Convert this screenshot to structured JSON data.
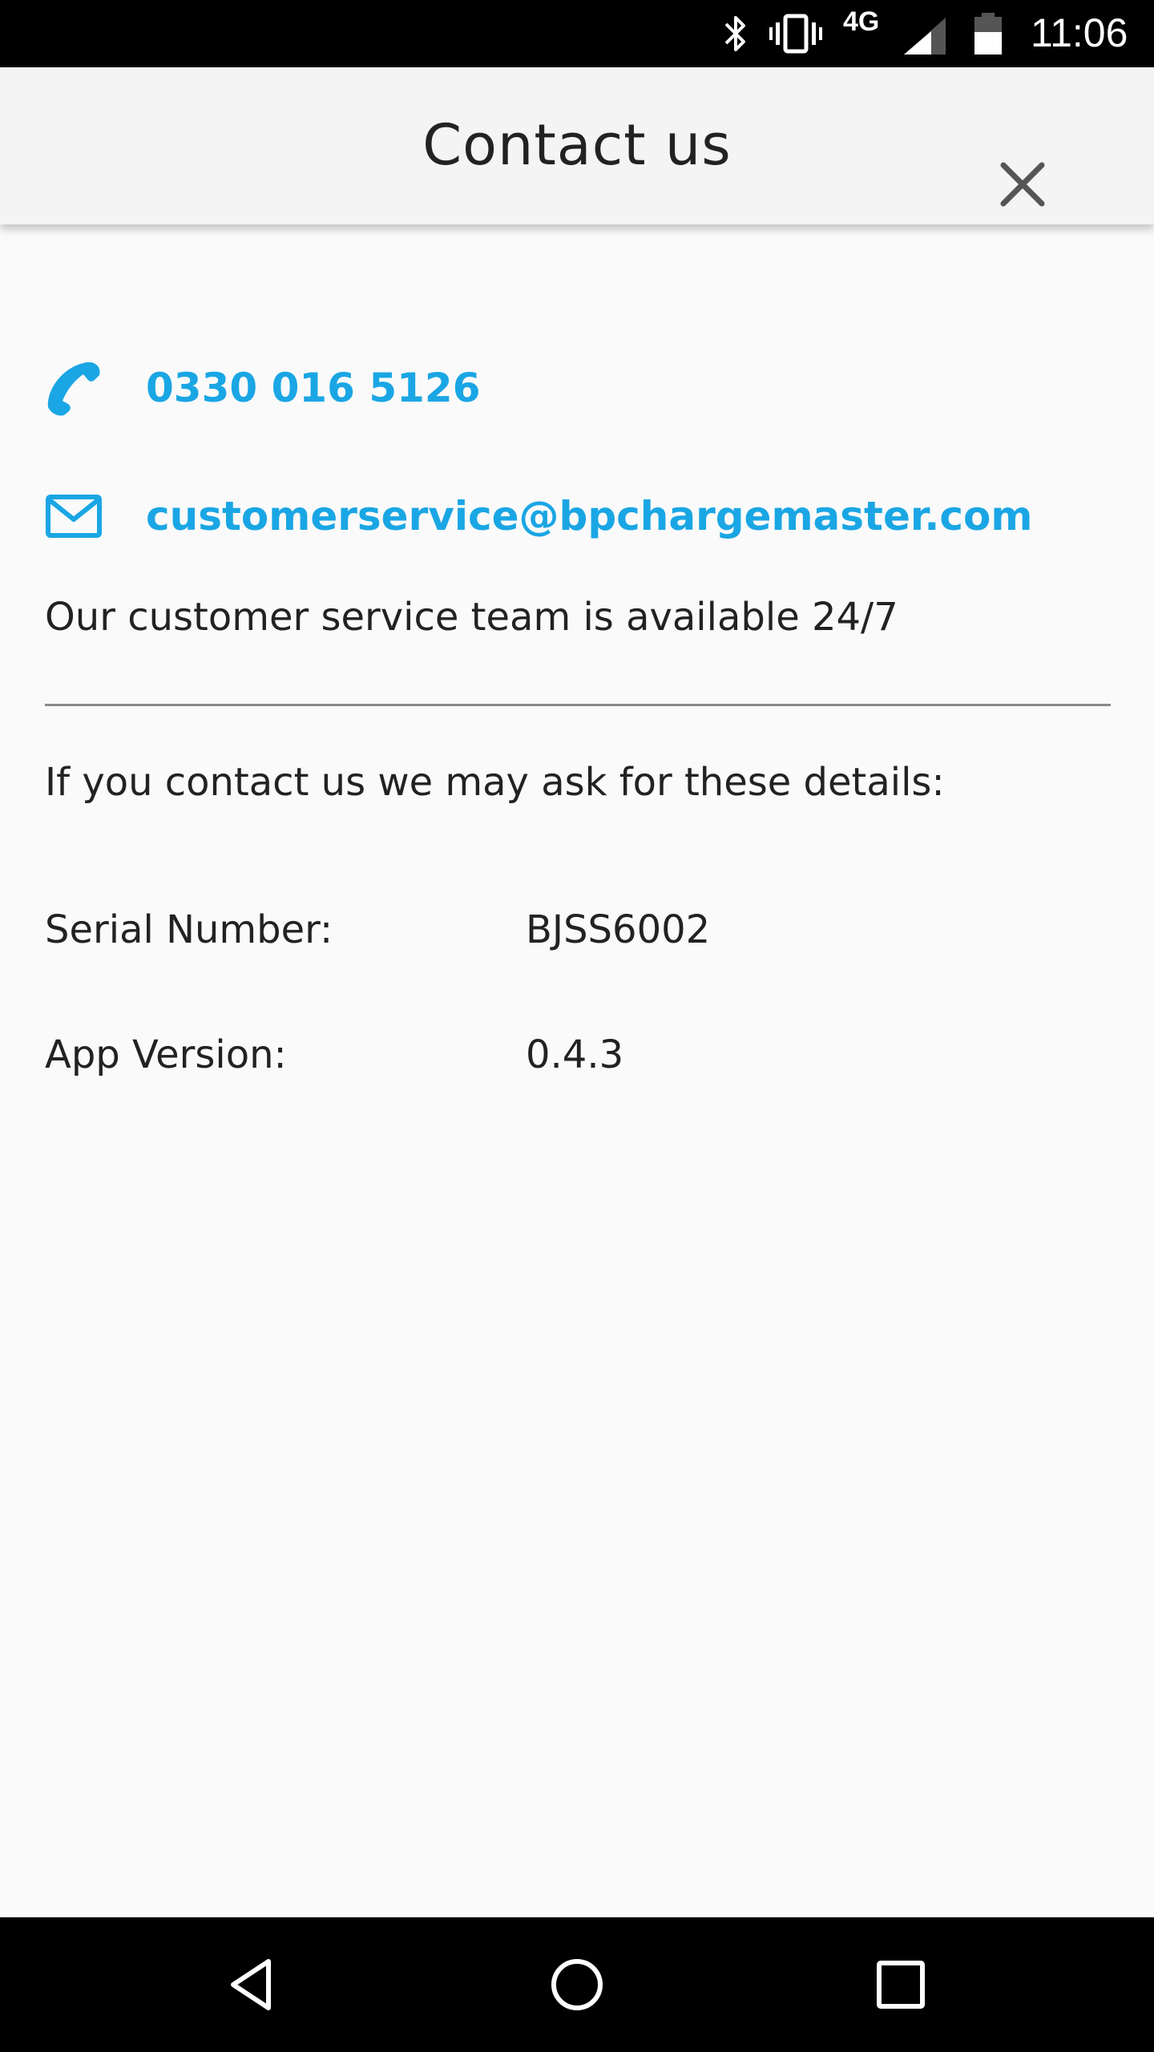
{
  "status_bar": {
    "network": "4G",
    "time": "11:06",
    "icons": [
      "bluetooth-icon",
      "vibrate-icon",
      "signal-icon",
      "battery-icon"
    ]
  },
  "app_bar": {
    "title": "Contact us",
    "close_icon": "close-icon"
  },
  "contact": {
    "phone": "0330 016 5126",
    "email": "customerservice@bpchargemaster.com",
    "availability": "Our customer service team is available 24/7"
  },
  "details": {
    "intro": "If you contact us we may ask for these details:",
    "serial_label": "Serial Number:",
    "serial_value": "BJSS6002",
    "version_label": "App Version:",
    "version_value": "0.4.3"
  },
  "nav_bar": {
    "icons": [
      "back-icon",
      "home-icon",
      "recents-icon"
    ]
  },
  "colors": {
    "accent": "#1aa6e4",
    "text": "#222222",
    "app_bar_bg": "#f4f4f4",
    "page_bg": "#fafafa"
  }
}
